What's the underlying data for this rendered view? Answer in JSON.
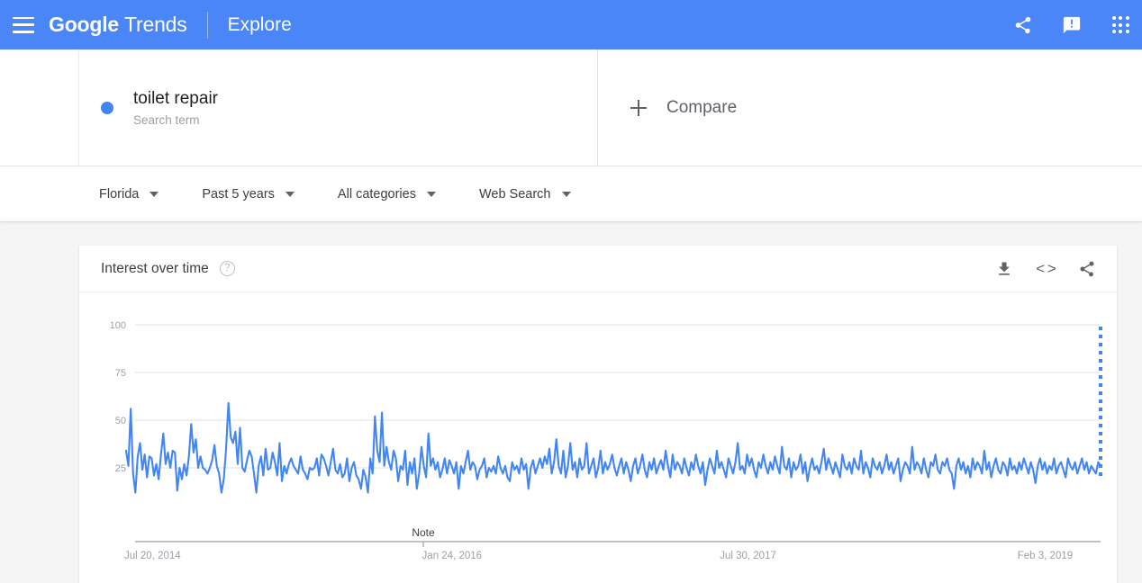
{
  "header": {
    "menu_icon": "hamburger-icon",
    "brand_bold": "Google",
    "brand_light": "Trends",
    "explore": "Explore",
    "share_icon": "share-icon",
    "feedback_icon": "feedback-icon",
    "apps_icon": "apps-grid-icon",
    "background_color": "#4a86f7"
  },
  "query": {
    "term": "toilet repair",
    "subtitle": "Search term",
    "dot_color": "#4285f4",
    "compare_label": "Compare",
    "compare_icon": "plus-icon"
  },
  "filters": [
    {
      "label": "Florida"
    },
    {
      "label": "Past 5 years"
    },
    {
      "label": "All categories"
    },
    {
      "label": "Web Search"
    }
  ],
  "card": {
    "title": "Interest over time",
    "help_icon": "help-circle-icon",
    "help_glyph": "?",
    "download_icon": "download-icon",
    "embed_icon": "embed-code-icon",
    "embed_glyph": "< >",
    "share_icon": "share-icon"
  },
  "chart_data": {
    "type": "line",
    "title": "Interest over time",
    "xlabel": "",
    "ylabel": "",
    "ylim": [
      0,
      100
    ],
    "yticks": [
      100,
      75,
      50,
      25
    ],
    "grid": true,
    "legend": false,
    "line_color": "#4285f4",
    "xticks": [
      {
        "label": "Jul 20, 2014",
        "pos": 0.0
      },
      {
        "label": "Jan 24, 2016",
        "pos": 0.3055
      },
      {
        "label": "Jul 30, 2017",
        "pos": 0.6111
      },
      {
        "label": "Feb 3, 2019",
        "pos": 0.9166
      }
    ],
    "annotations": [
      {
        "label": "Note",
        "pos": 0.305
      }
    ],
    "partial_data_marker": {
      "pos": 1.0,
      "style": "dotted-vertical",
      "color": "#4285f4"
    },
    "series": [
      {
        "name": "toilet repair",
        "values": [
          34,
          26,
          56,
          22,
          12,
          31,
          38,
          24,
          32,
          20,
          31,
          30,
          21,
          27,
          19,
          32,
          43,
          27,
          33,
          25,
          34,
          33,
          13,
          25,
          19,
          27,
          21,
          31,
          48,
          33,
          40,
          25,
          31,
          25,
          24,
          22,
          25,
          29,
          37,
          26,
          22,
          12,
          19,
          35,
          59,
          41,
          38,
          44,
          27,
          46,
          25,
          23,
          29,
          34,
          31,
          22,
          12,
          26,
          31,
          21,
          35,
          24,
          25,
          33,
          28,
          21,
          38,
          18,
          26,
          22,
          27,
          30,
          26,
          24,
          22,
          31,
          24,
          22,
          19,
          25,
          24,
          25,
          30,
          21,
          32,
          30,
          26,
          21,
          28,
          35,
          24,
          22,
          27,
          20,
          22,
          30,
          18,
          25,
          28,
          21,
          19,
          14,
          24,
          20,
          12,
          30,
          22,
          52,
          34,
          28,
          54,
          26,
          36,
          28,
          24,
          34,
          30,
          18,
          26,
          24,
          34,
          16,
          28,
          22,
          30,
          14,
          22,
          36,
          26,
          20,
          43,
          26,
          30,
          24,
          28,
          20,
          24,
          30,
          22,
          29,
          26,
          22,
          28,
          14,
          26,
          22,
          28,
          34,
          24,
          28,
          26,
          19,
          24,
          26,
          30,
          20,
          25,
          23,
          26,
          22,
          31,
          25,
          22,
          26,
          20,
          18,
          28,
          24,
          26,
          22,
          30,
          24,
          27,
          14,
          25,
          29,
          22,
          26,
          30,
          25,
          31,
          27,
          35,
          22,
          28,
          40,
          26,
          22,
          34,
          20,
          26,
          38,
          24,
          28,
          20,
          30,
          24,
          26,
          38,
          22,
          26,
          30,
          20,
          25,
          34,
          22,
          28,
          24,
          27,
          32,
          25,
          21,
          26,
          30,
          22,
          28,
          24,
          18,
          26,
          30,
          22,
          26,
          32,
          24,
          20,
          28,
          24,
          30,
          22,
          26,
          29,
          24,
          34,
          26,
          20,
          32,
          24,
          28,
          26,
          22,
          30,
          25,
          21,
          28,
          24,
          32,
          26,
          22,
          28,
          16,
          24,
          30,
          26,
          22,
          34,
          25,
          28,
          24,
          20,
          30,
          26,
          22,
          28,
          38,
          24,
          26,
          22,
          32,
          26,
          30,
          24,
          20,
          28,
          25,
          32,
          26,
          22,
          28,
          24,
          31,
          26,
          22,
          36,
          26,
          24,
          30,
          20,
          28,
          24,
          26,
          32,
          22,
          28,
          18,
          25,
          30,
          24,
          26,
          22,
          28,
          35,
          24,
          30,
          26,
          22,
          28,
          24,
          20,
          32,
          26,
          24,
          28,
          22,
          30,
          26,
          24,
          34,
          22,
          28,
          25,
          20,
          30,
          26,
          24,
          28,
          22,
          26,
          32,
          24,
          28,
          22,
          26,
          30,
          18,
          24,
          28,
          26,
          22,
          36,
          24,
          28,
          26,
          22,
          30,
          24,
          20,
          28,
          26,
          32,
          24,
          22,
          28,
          26,
          30,
          24,
          22,
          14,
          26,
          30,
          24,
          28,
          22,
          26,
          20,
          30,
          24,
          28,
          26,
          22,
          34,
          24,
          28,
          20,
          26,
          30,
          24,
          22,
          28,
          26,
          21,
          30,
          24,
          26,
          22,
          28,
          24,
          30,
          26,
          22,
          28,
          24,
          17,
          26,
          30,
          24,
          28,
          22,
          26,
          24,
          30,
          22,
          26,
          28,
          24,
          20,
          30,
          26,
          24,
          28,
          22,
          26,
          30,
          24,
          28,
          22,
          26,
          24,
          22,
          28,
          26
        ]
      }
    ]
  }
}
